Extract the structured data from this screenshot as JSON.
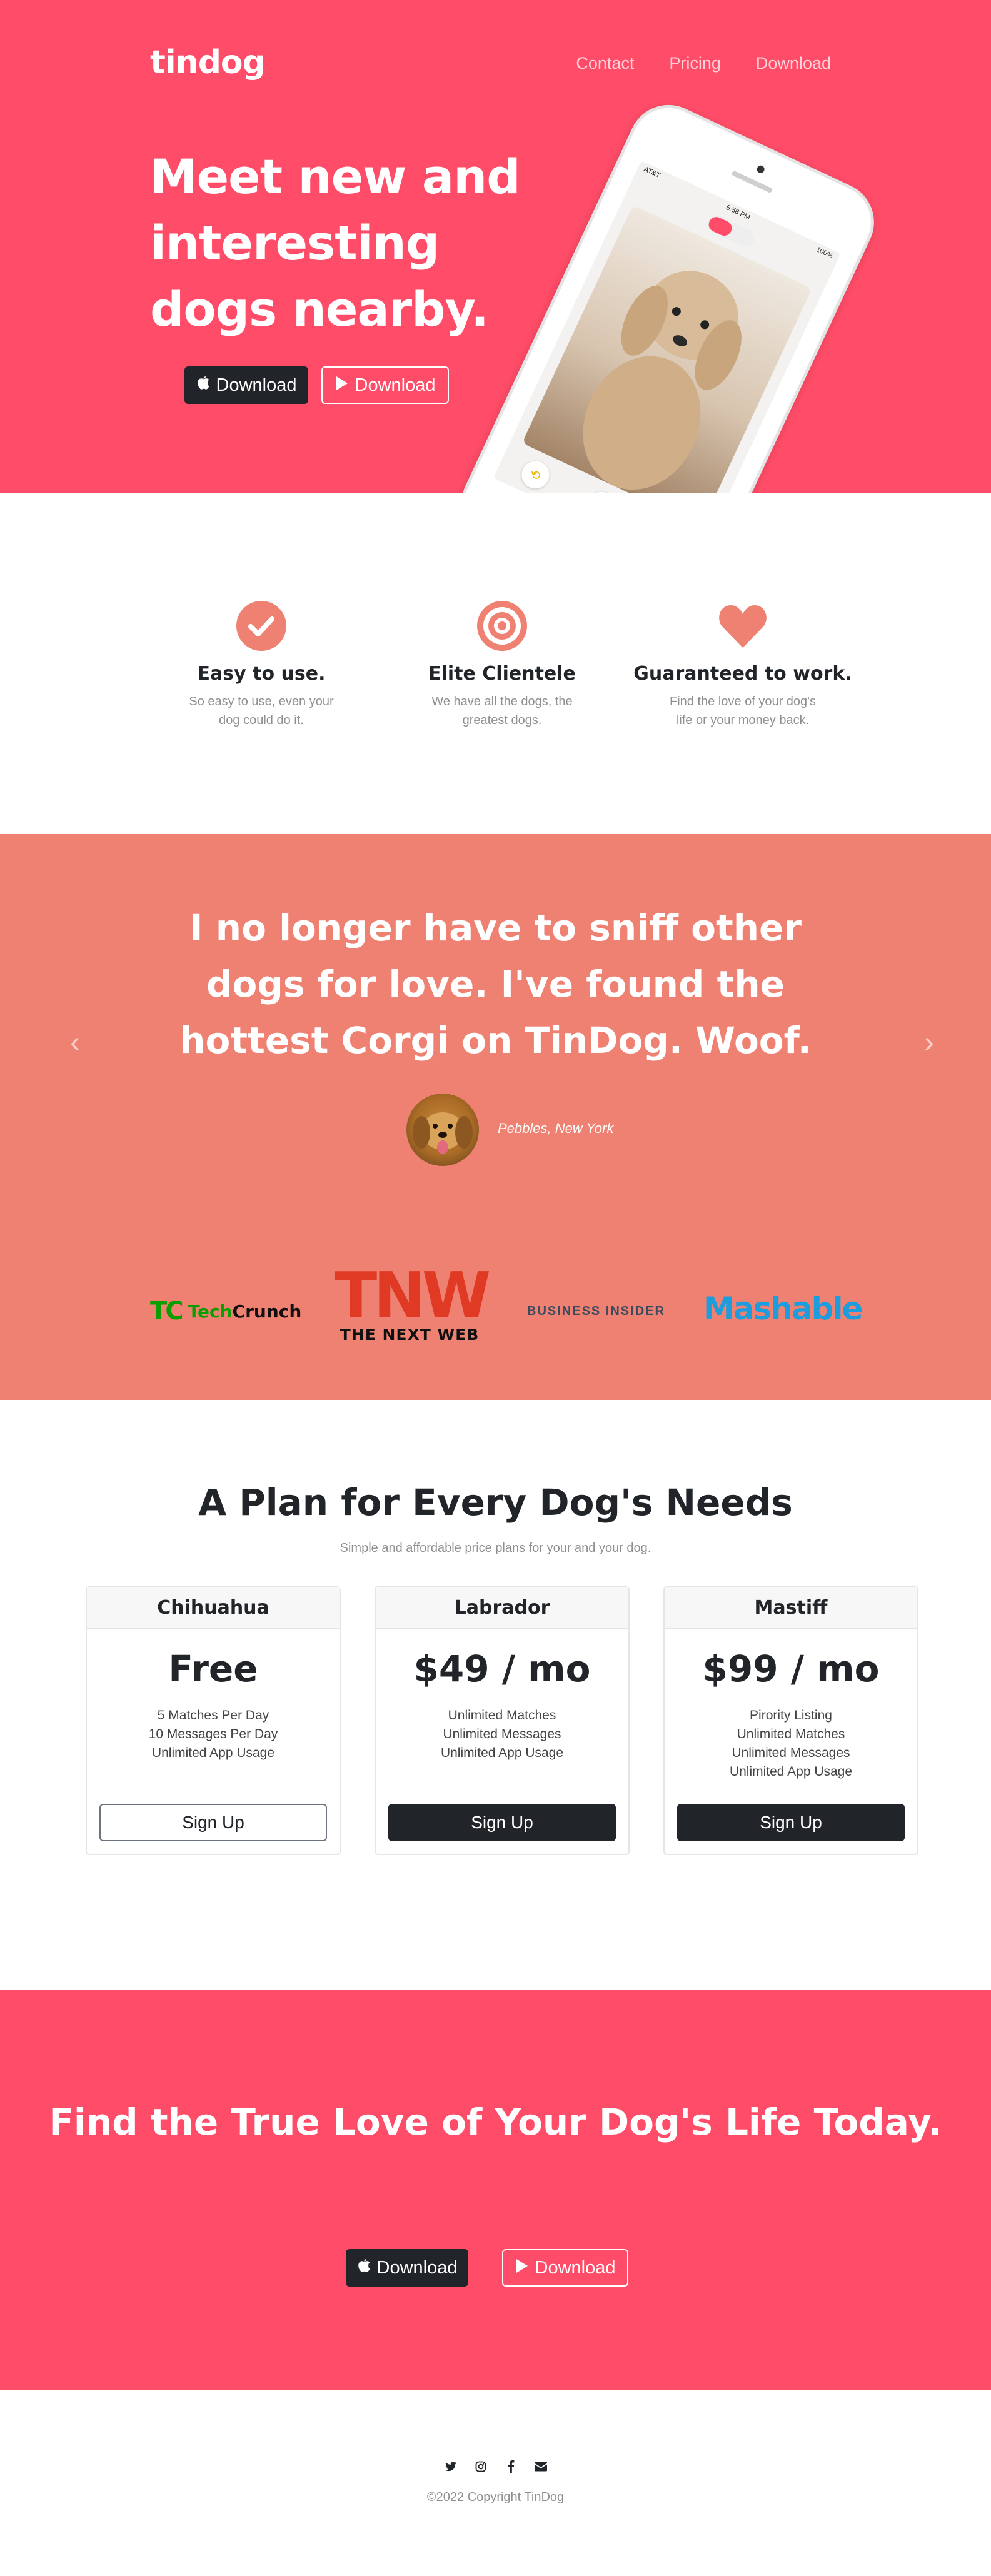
{
  "header": {
    "brand": "tindog",
    "nav": [
      "Contact",
      "Pricing",
      "Download"
    ]
  },
  "hero": {
    "title": "Meet new and interesting dogs nearby.",
    "buttons": [
      {
        "label": "Download",
        "icon": "apple-icon",
        "style": "dark"
      },
      {
        "label": "Download",
        "icon": "google-play-icon",
        "style": "outline-light"
      }
    ],
    "phone": {
      "status_left": "AT&T",
      "status_time": "5:58 PM",
      "status_right": "100%"
    }
  },
  "features": [
    {
      "icon": "check-circle-icon",
      "title": "Easy to use.",
      "text": "So easy to use, even your dog could do it."
    },
    {
      "icon": "bullseye-icon",
      "title": "Elite Clientele",
      "text": "We have all the dogs, the greatest dogs."
    },
    {
      "icon": "heart-icon",
      "title": "Guaranteed to work.",
      "text": "Find the love of your dog's life or your money back."
    }
  ],
  "testimonial": {
    "quote": "I no longer have to sniff other dogs for love. I've found the hottest Corgi on TinDog. Woof.",
    "author": "Pebbles, New York",
    "prev": "‹",
    "next": "›"
  },
  "press": {
    "techcrunch_mark": "TC",
    "techcrunch_word_1": "Tech",
    "techcrunch_word_2": "Crunch",
    "tnw_big": "TNW",
    "tnw_small": "THE NEXT WEB",
    "business_insider": "BUSINESS INSIDER",
    "mashable": "Mashable"
  },
  "pricing": {
    "title": "A Plan for Every Dog's Needs",
    "subtitle": "Simple and affordable price plans for your and your dog.",
    "plans": [
      {
        "name": "Chihuahua",
        "price": "Free",
        "features": [
          "5 Matches Per Day",
          "10 Messages Per Day",
          "Unlimited App Usage"
        ],
        "button": "Sign Up"
      },
      {
        "name": "Labrador",
        "price": "$49 / mo",
        "features": [
          "Unlimited Matches",
          "Unlimited Messages",
          "Unlimited App Usage"
        ],
        "button": "Sign Up"
      },
      {
        "name": "Mastiff",
        "price": "$99 / mo",
        "features": [
          "Pirority Listing",
          "Unlimited Matches",
          "Unlimited Messages",
          "Unlimited App Usage"
        ],
        "button": "Sign Up"
      }
    ]
  },
  "cta": {
    "title": "Find the True Love of Your Dog's Life Today.",
    "buttons": [
      {
        "label": "Download",
        "icon": "apple-icon",
        "style": "dark"
      },
      {
        "label": "Download",
        "icon": "google-play-icon",
        "style": "outline-light"
      }
    ]
  },
  "footer": {
    "social": [
      "twitter-icon",
      "instagram-icon",
      "facebook-icon",
      "envelope-icon"
    ],
    "copyright": "©2022 Copyright TinDog"
  },
  "colors": {
    "brand_red": "#ff4c68",
    "coral": "#ef8172",
    "dark": "#212529"
  }
}
